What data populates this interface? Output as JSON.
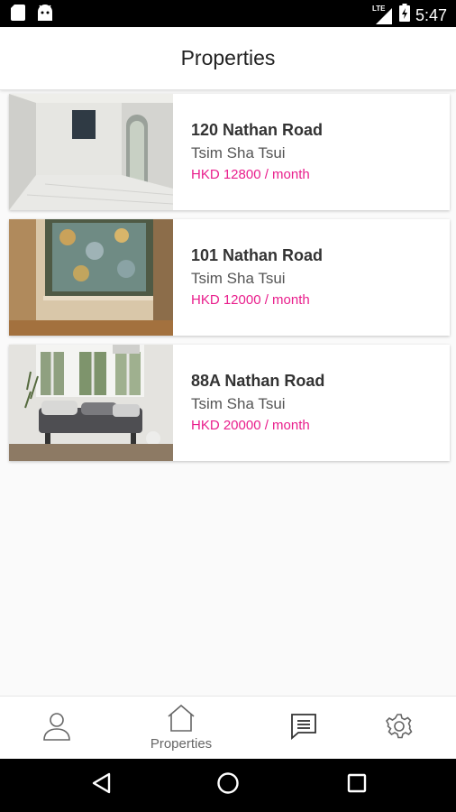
{
  "status_bar": {
    "time": "5:47",
    "network": "LTE",
    "icons": [
      "sd-card-icon",
      "android-icon",
      "signal-icon",
      "battery-icon"
    ]
  },
  "header": {
    "title": "Properties"
  },
  "properties": [
    {
      "address": "120 Nathan Road",
      "area": "Tsim Sha Tsui",
      "price": "HKD 12800 / month",
      "photo": "empty-room-photo"
    },
    {
      "address": "101 Nathan Road",
      "area": "Tsim Sha Tsui",
      "price": "HKD 12000 / month",
      "photo": "curtain-room-photo"
    },
    {
      "address": "88A Nathan Road",
      "area": "Tsim Sha Tsui",
      "price": "HKD 20000 / month",
      "photo": "living-room-photo"
    }
  ],
  "bottom_nav": {
    "items": [
      {
        "id": "profile",
        "label": "",
        "icon": "user-icon"
      },
      {
        "id": "properties",
        "label": "Properties",
        "icon": "home-icon"
      },
      {
        "id": "messages",
        "label": "",
        "icon": "chat-icon"
      },
      {
        "id": "settings",
        "label": "",
        "icon": "gear-icon"
      }
    ]
  },
  "colors": {
    "price": "#e91e8c",
    "header_bg": "#ffffff",
    "page_bg": "#fafafa"
  }
}
